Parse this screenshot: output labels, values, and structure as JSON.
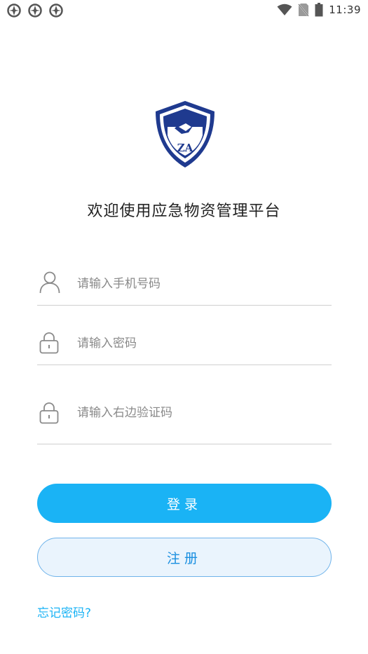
{
  "status_bar": {
    "time": "11:39",
    "left_icons": [
      "notification-icon",
      "notification-icon",
      "notification-icon"
    ],
    "right_icons": [
      "wifi-icon",
      "no-sim-icon",
      "battery-icon"
    ]
  },
  "logo": {
    "text": "ZA",
    "color": "#1f3a8f"
  },
  "welcome": {
    "title": "欢迎使用应急物资管理平台"
  },
  "form": {
    "phone": {
      "placeholder": "请输入手机号码",
      "value": ""
    },
    "password": {
      "placeholder": "请输入密码",
      "value": ""
    },
    "captcha": {
      "placeholder": "请输入右边验证码",
      "value": ""
    }
  },
  "actions": {
    "login_label": "登录",
    "register_label": "注册",
    "forgot_label": "忘记密码?"
  },
  "colors": {
    "accent": "#1ab3f5",
    "register_bg": "#eaf4fd",
    "register_text": "#1a8fe0"
  }
}
